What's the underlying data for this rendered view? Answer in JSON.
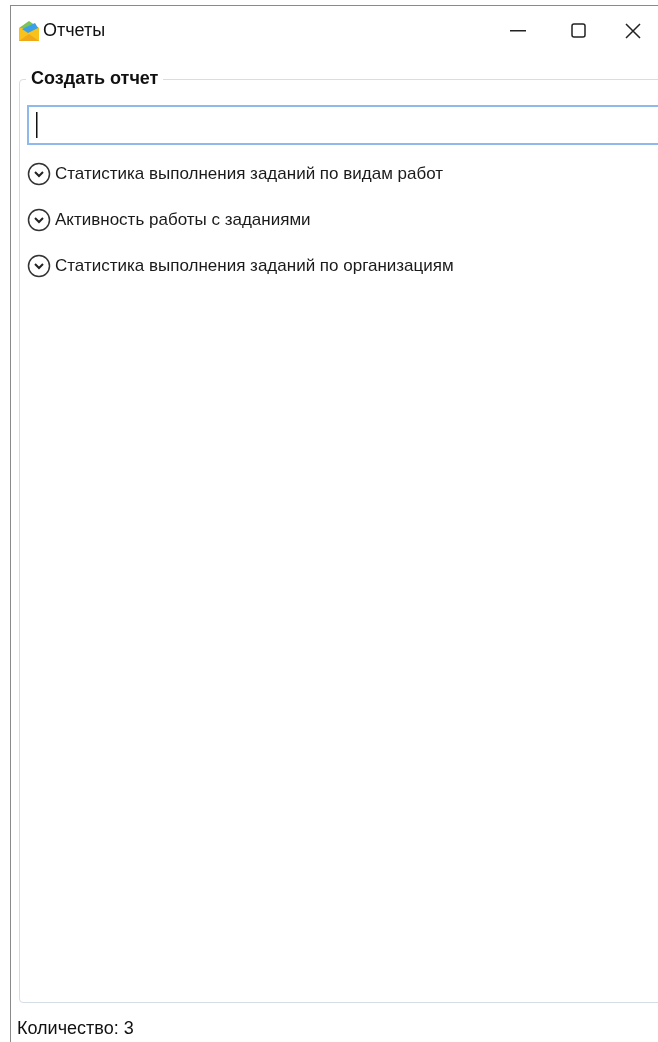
{
  "window": {
    "title": "Отчеты"
  },
  "group": {
    "title": "Создать отчет",
    "items": [
      {
        "label": "Статистика выполнения заданий по видам работ",
        "expanded": false
      },
      {
        "label": "Активность работы с заданиями",
        "expanded": false
      },
      {
        "label": "Статистика выполнения заданий по организациям",
        "expanded": false
      }
    ]
  },
  "status_bar": {
    "count": "Количество: 3"
  }
}
